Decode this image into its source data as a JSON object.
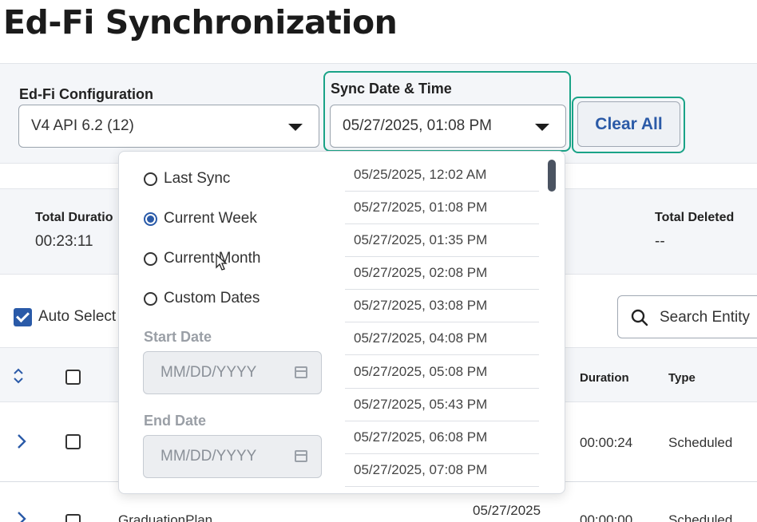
{
  "page": {
    "title": "Ed-Fi Synchronization"
  },
  "filters": {
    "config_label": "Ed-Fi Configuration",
    "config_value": "V4 API 6.2 (12)",
    "sync_label": "Sync Date & Time",
    "sync_value": "05/27/2025, 01:08 PM",
    "clear_label": "Clear All",
    "highlight_color": "#1aa387"
  },
  "stats": {
    "total_duration_label": "Total Duratio",
    "total_duration_value": "00:23:11",
    "total_deleted_label": "Total Deleted",
    "total_deleted_value": "--"
  },
  "toolbar": {
    "auto_select_label": "Auto Select",
    "auto_select_checked": true,
    "search_placeholder": "Search Entity"
  },
  "table": {
    "headers": {
      "duration": "Duration",
      "type": "Type"
    },
    "rows": [
      {
        "name": "",
        "date": "",
        "duration": "00:00:24",
        "type": "Scheduled"
      },
      {
        "name": "GraduationPlan",
        "date": "05/27/2025",
        "duration": "00:00:00",
        "type": "Scheduled"
      }
    ]
  },
  "dropdown": {
    "options": [
      {
        "label": "Last Sync",
        "selected": false
      },
      {
        "label": "Current Week",
        "selected": true
      },
      {
        "label": "Current Month",
        "selected": false
      },
      {
        "label": "Custom Dates",
        "selected": false
      }
    ],
    "start_date_label": "Start Date",
    "start_date_placeholder": "MM/DD/YYYY",
    "end_date_label": "End Date",
    "end_date_placeholder": "MM/DD/YYYY",
    "timestamps": [
      "05/25/2025, 12:02 AM",
      "05/27/2025, 01:08 PM",
      "05/27/2025, 01:35 PM",
      "05/27/2025, 02:08 PM",
      "05/27/2025, 03:08 PM",
      "05/27/2025, 04:08 PM",
      "05/27/2025, 05:08 PM",
      "05/27/2025, 05:43 PM",
      "05/27/2025, 06:08 PM",
      "05/27/2025, 07:08 PM"
    ]
  },
  "colors": {
    "accent": "#2a5aa8",
    "panel_bg": "#f4f6f9"
  }
}
